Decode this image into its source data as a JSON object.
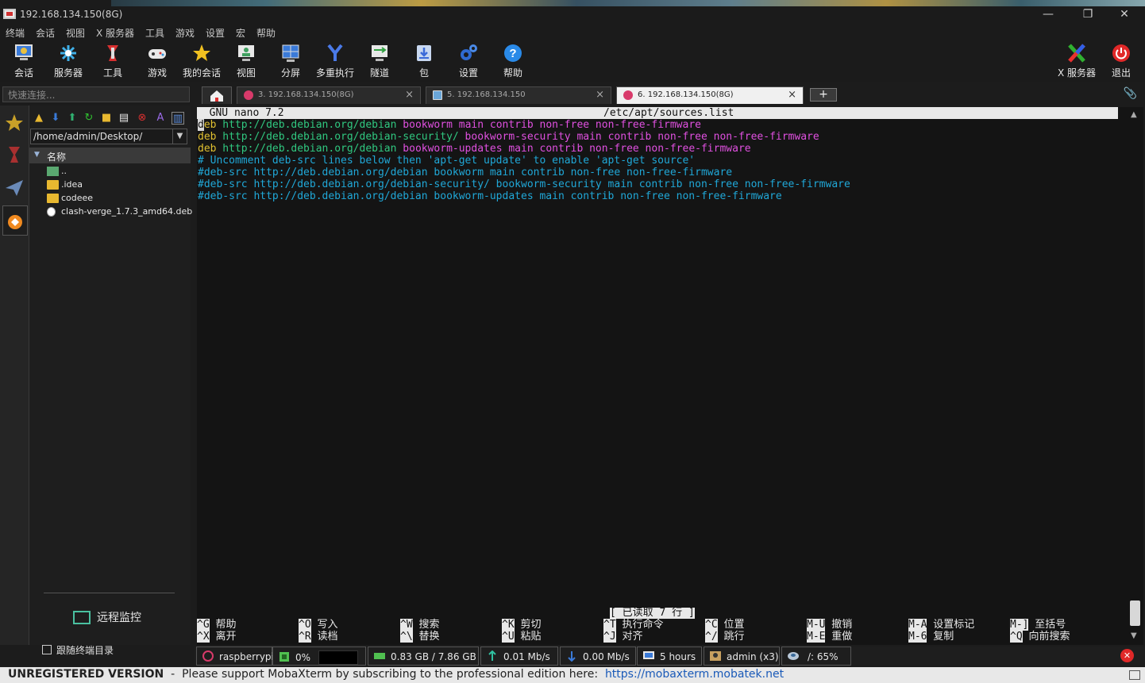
{
  "window": {
    "title": "192.168.134.150(8G)"
  },
  "menu": [
    "终端",
    "会话",
    "视图",
    "X 服务器",
    "工具",
    "游戏",
    "设置",
    "宏",
    "帮助"
  ],
  "toolbar": {
    "session": "会话",
    "servers": "服务器",
    "tools": "工具",
    "games": "游戏",
    "my_sessions": "我的会话",
    "view": "视图",
    "split": "分屏",
    "multiexec": "多重执行",
    "tunnel": "隧道",
    "packages": "包",
    "settings": "设置",
    "help": "帮助",
    "xserver": "X 服务器",
    "exit": "退出"
  },
  "quick_connect": {
    "placeholder": "快速连接..."
  },
  "tabs": [
    {
      "label": "3. 192.168.134.150(8G)",
      "active": false
    },
    {
      "label": "5. 192.168.134.150",
      "active": false
    },
    {
      "label": "6. 192.168.134.150(8G)",
      "active": true
    }
  ],
  "file_browser": {
    "path": "/home/admin/Desktop/",
    "column_header": "名称",
    "items": [
      "..",
      ".idea",
      "codeee",
      "clash-verge_1.7.3_amd64.deb"
    ],
    "remote_monitor": "远程监控",
    "follow_terminal": "跟随终端目录"
  },
  "terminal": {
    "header_left": "  GNU nano 7.2",
    "header_title": "/etc/apt/sources.list",
    "lines": [
      {
        "kw": "deb",
        "url": " http://deb.debian.org/debian",
        "suite": " bookworm",
        "comps": " main contrib non-free non-free-firmware"
      },
      {
        "kw": "deb",
        "url": " http://deb.debian.org/debian-security/",
        "suite": " bookworm-security",
        "comps": " main contrib non-free non-free-firmware"
      },
      {
        "kw": "deb",
        "url": " http://deb.debian.org/debian",
        "suite": " bookworm-updates",
        "comps": " main contrib non-free non-free-firmware"
      }
    ],
    "comment_line": "# Uncomment deb-src lines below then 'apt-get update' to enable 'apt-get source'",
    "commented_lines": [
      "#deb-src http://deb.debian.org/debian bookworm main contrib non-free non-free-firmware",
      "#deb-src http://deb.debian.org/debian-security/ bookworm-security main contrib non-free non-free-firmware",
      "#deb-src http://deb.debian.org/debian bookworm-updates main contrib non-free non-free-firmware"
    ],
    "status_message": "[ 已读取 7 行 ]",
    "shortcuts": [
      {
        "k1": "^G",
        "l1": "帮助",
        "k2": "^X",
        "l2": "离开"
      },
      {
        "k1": "^O",
        "l1": "写入",
        "k2": "^R",
        "l2": "读档"
      },
      {
        "k1": "^W",
        "l1": "搜索",
        "k2": "^\\",
        "l2": "替换"
      },
      {
        "k1": "^K",
        "l1": "剪切",
        "k2": "^U",
        "l2": "粘贴"
      },
      {
        "k1": "^T",
        "l1": "执行命令",
        "k2": "^J",
        "l2": "对齐"
      },
      {
        "k1": "^C",
        "l1": "位置",
        "k2": "^/",
        "l2": "跳行"
      },
      {
        "k1": "M-U",
        "l1": "撤销",
        "k2": "M-E",
        "l2": "重做"
      },
      {
        "k1": "M-A",
        "l1": "设置标记",
        "k2": "M-6",
        "l2": "复制"
      },
      {
        "k1": "M-]",
        "l1": "至括号",
        "k2": "^Q",
        "l2": "向前搜索"
      }
    ]
  },
  "statusbar": {
    "host": "raspberrypi",
    "cpu": "0%",
    "memory": "0.83 GB / 7.86 GB",
    "upload": "0.01 Mb/s",
    "download": "0.00 Mb/s",
    "uptime": "5 hours",
    "users": "admin (x3)",
    "disk": "/: 65%"
  },
  "banner": {
    "unregistered": "UNREGISTERED VERSION",
    "message": "  -  Please support MobaXterm by subscribing to the professional edition here:  ",
    "link": "https://mobaxterm.mobatek.net"
  },
  "colors": {
    "terminal_bg": "#141414",
    "deb_keyword": "#e0c030",
    "url": "#30c880",
    "suite": "#e050e0",
    "comment": "#20a8d8",
    "link": "#1a5ab8"
  }
}
